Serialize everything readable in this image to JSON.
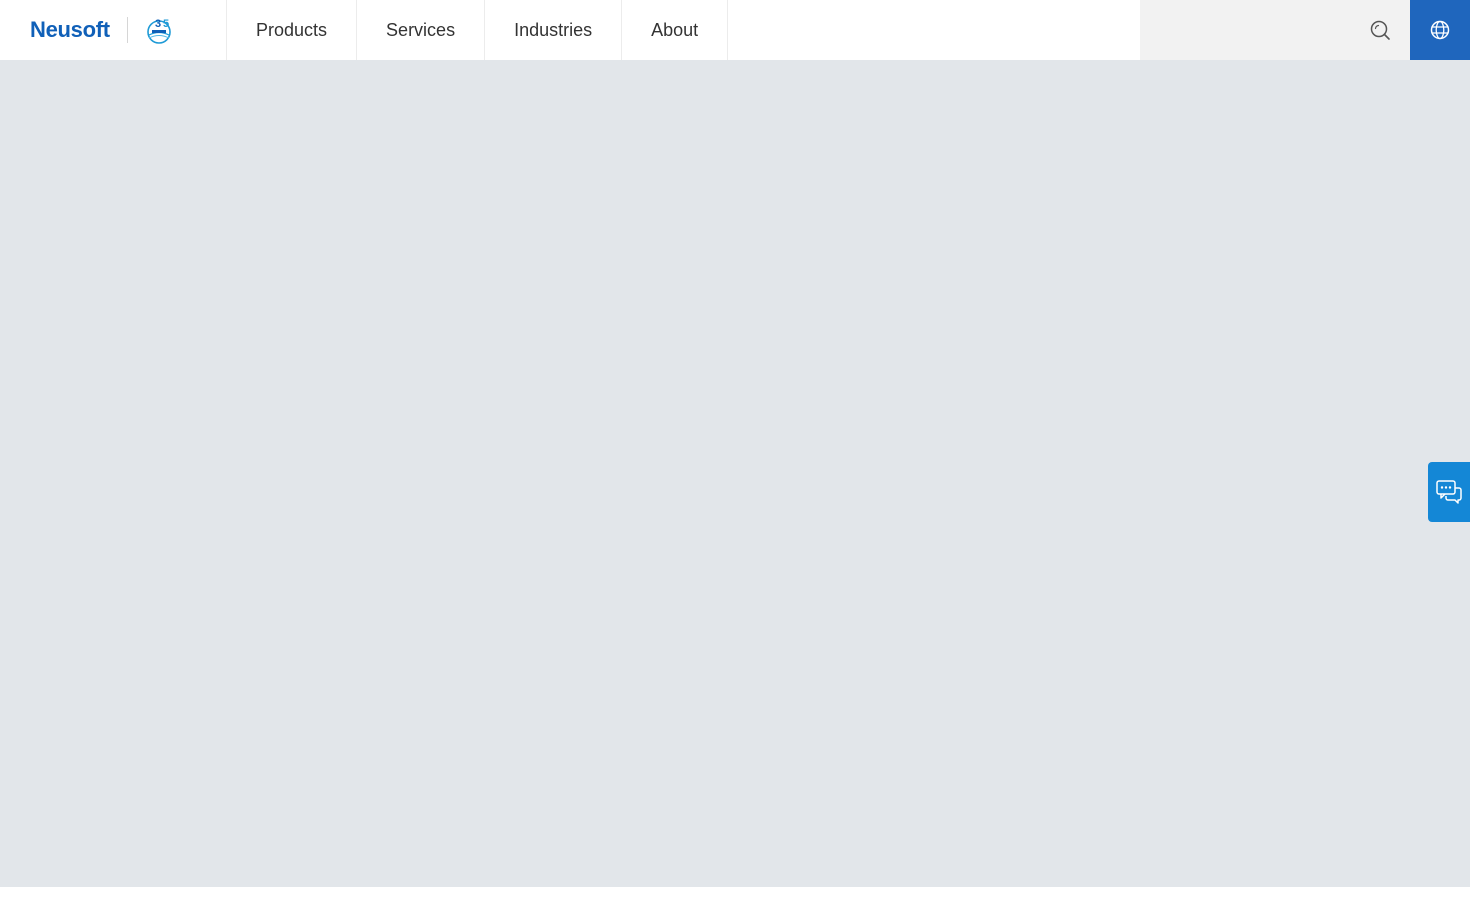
{
  "brand": {
    "name": "Neusoft",
    "color": "#1060b8",
    "anniversary_logo": "35th-anniversary-logo-icon"
  },
  "nav": {
    "items": [
      {
        "label": "Products"
      },
      {
        "label": "Services"
      },
      {
        "label": "Industries"
      },
      {
        "label": "About"
      }
    ]
  },
  "search": {
    "value": "",
    "placeholder": "",
    "icon": "search-icon"
  },
  "language": {
    "icon": "globe-icon",
    "color": "#1f66bd"
  },
  "chat": {
    "icon": "chat-bubbles-icon",
    "color": "#1487d6"
  },
  "hero": {
    "background": "#e2e6ea"
  }
}
